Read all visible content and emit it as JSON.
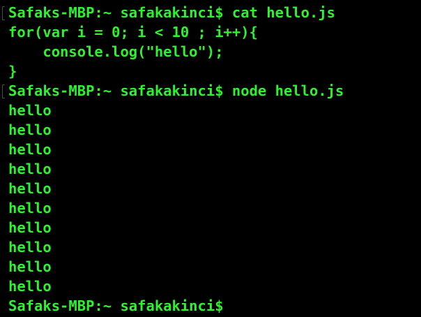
{
  "theme": {
    "background": "#000000",
    "foreground": "#2ff22f"
  },
  "terminal": {
    "lines": [
      {
        "text": "Safaks-MBP:~ safakakinci$ cat hello.js",
        "kind": "prompt"
      },
      {
        "text": "for(var i = 0; i < 10 ; i++){",
        "kind": "output"
      },
      {
        "text": "    console.log(\"hello\");",
        "kind": "output"
      },
      {
        "text": "}",
        "kind": "output"
      },
      {
        "text": "Safaks-MBP:~ safakakinci$ node hello.js",
        "kind": "prompt"
      },
      {
        "text": "hello",
        "kind": "output"
      },
      {
        "text": "hello",
        "kind": "output"
      },
      {
        "text": "hello",
        "kind": "output"
      },
      {
        "text": "hello",
        "kind": "output"
      },
      {
        "text": "hello",
        "kind": "output"
      },
      {
        "text": "hello",
        "kind": "output"
      },
      {
        "text": "hello",
        "kind": "output"
      },
      {
        "text": "hello",
        "kind": "output"
      },
      {
        "text": "hello",
        "kind": "output"
      },
      {
        "text": "hello",
        "kind": "output"
      },
      {
        "text": "Safaks-MBP:~ safakakinci$",
        "kind": "prompt"
      }
    ]
  }
}
